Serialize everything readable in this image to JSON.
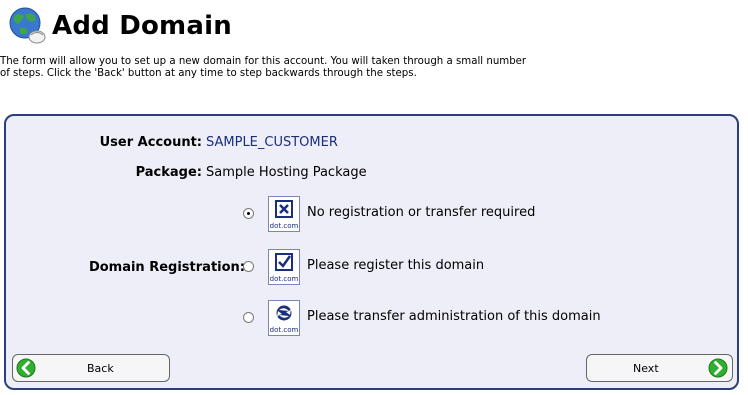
{
  "page": {
    "title": "Add Domain",
    "intro_line1": "The form will allow you to set up a new domain for this account. You will taken through a small number",
    "intro_line2": "of steps. Click the 'Back' button at any time to step backwards through the steps."
  },
  "form": {
    "user_account_label": "User Account:",
    "user_account_value": "SAMPLE_CUSTOMER",
    "package_label": "Package:",
    "package_value": "Sample Hosting Package",
    "domain_registration_label": "Domain Registration:",
    "options": [
      {
        "label": "No registration or transfer required",
        "icon": "no-registration-icon",
        "icon_caption": "dot.com",
        "selected": true
      },
      {
        "label": "Please register this domain",
        "icon": "register-domain-icon",
        "icon_caption": "dot.com",
        "selected": false
      },
      {
        "label": "Please transfer administration of this domain",
        "icon": "transfer-domain-icon",
        "icon_caption": "dot.com",
        "selected": false
      }
    ]
  },
  "buttons": {
    "back_label": "Back",
    "next_label": "Next"
  },
  "colors": {
    "panel_bg": "#eeeef8",
    "panel_border": "#2a3f7c",
    "accent_text": "#1a2f7a",
    "arrow_green": "#2fae2f"
  }
}
